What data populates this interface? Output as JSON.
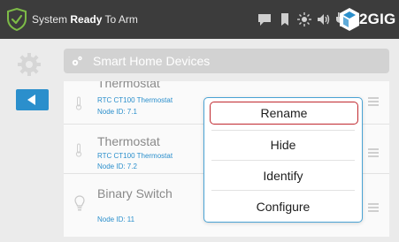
{
  "statusbar": {
    "status_prefix": "System",
    "status_bold": "Ready",
    "status_suffix": "To Arm",
    "icons": [
      "chat-bubble-icon",
      "bookmark-icon",
      "brightness-icon",
      "volume-icon",
      "power-plug-icon"
    ],
    "brand": "2GIG"
  },
  "sidebar": {
    "settings_icon": "gear-icon",
    "back_icon": "back-arrow-icon"
  },
  "page": {
    "title": "Smart Home Devices",
    "title_icon": "smart-home-icon"
  },
  "devices": [
    {
      "name": "Thermostat",
      "model": "RTC CT100 Thermostat",
      "node": "Node ID: 7.1",
      "icon": "thermometer-icon"
    },
    {
      "name": "Thermostat",
      "model": "RTC CT100 Thermostat",
      "node": "Node ID: 7.2",
      "icon": "thermometer-icon"
    },
    {
      "name": "Binary Switch",
      "model": "",
      "node": "Node ID: 11",
      "icon": "light-bulb-icon"
    }
  ],
  "context_menu": {
    "items": [
      "Rename",
      "Hide",
      "Identify",
      "Configure"
    ],
    "selected": "Rename"
  },
  "colors": {
    "accent": "#2b8fcc",
    "statusbar_bg": "#3c3c3c",
    "shield_green": "#7dbb47",
    "selected_border": "#c0282e"
  }
}
